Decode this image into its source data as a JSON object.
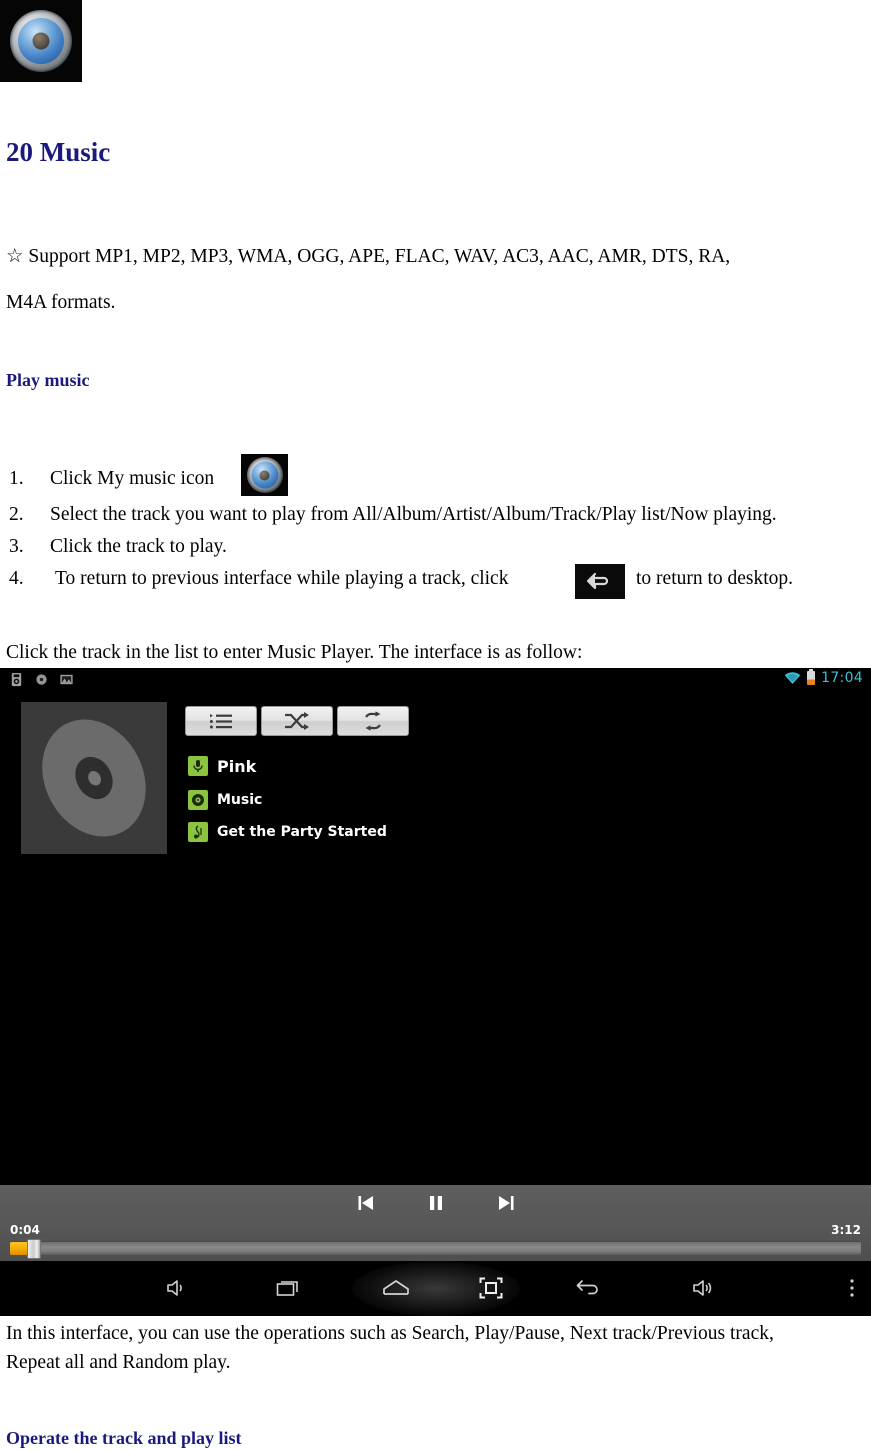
{
  "document": {
    "app_icon_name": "music-app-icon",
    "heading": "20 Music",
    "formats_line1": "☆  Support MP1, MP2, MP3, WMA, OGG, APE, FLAC, WAV, AC3, AAC, AMR, DTS, RA,",
    "formats_line2": "M4A formats.",
    "subheading_play": "Play music",
    "subheading_operate": "Operate the track and play list",
    "caption_follow": "Click the track in the list to enter Music Player. The interface is as follow:",
    "after_line1": "In this interface, you can use the operations such as Search, Play/Pause, Next track/Previous track,",
    "after_line2": "Repeat all and Random play.",
    "heading_color": "#1a1a7e",
    "steps": [
      {
        "num": "1.",
        "text": "Click My music icon"
      },
      {
        "num": "2.",
        "text": "Select the track you want to play from All/Album/Artist/Album/Track/Play list/Now playing."
      },
      {
        "num": "3.",
        "text": "Click the track to play."
      },
      {
        "num": "4.",
        "text_before": " To return to previous interface while playing a track, click",
        "text_after": "to return to desktop."
      }
    ]
  },
  "tablet": {
    "status_bar": {
      "notification_icons": [
        "usb-android-icon",
        "record-icon",
        "picture-icon"
      ],
      "wifi_icon": "wifi-icon",
      "battery_icon": "battery-icon",
      "clock": "17:04",
      "accent_color": "#3fbfd4"
    },
    "album_art": {
      "name": "album-art-placeholder",
      "icon": "cd-disc-icon"
    },
    "mode_buttons": [
      {
        "name": "playlist-button",
        "icon": "playlist-icon"
      },
      {
        "name": "shuffle-button",
        "icon": "shuffle-icon"
      },
      {
        "name": "repeat-button",
        "icon": "repeat-icon"
      }
    ],
    "now_playing": {
      "artist": "Pink",
      "artist_icon": "microphone-icon",
      "album": "Music",
      "album_icon": "disc-icon",
      "track": "Get the Party Started",
      "track_icon": "music-note-icon",
      "badge_color": "#8bc53f"
    },
    "player": {
      "prev_label": "previous-track",
      "pause_label": "pause",
      "next_label": "next-track",
      "elapsed": "0:04",
      "duration": "3:12",
      "progress_percent": 2,
      "progress_color": "#f5a800"
    },
    "nav_bar": {
      "buttons": [
        {
          "name": "volume-up-button",
          "icon": "volume-up-icon"
        },
        {
          "name": "recent-apps-button",
          "icon": "recent-apps-icon"
        },
        {
          "name": "home-button",
          "icon": "home-icon"
        },
        {
          "name": "screenshot-button",
          "icon": "screenshot-icon"
        },
        {
          "name": "back-button",
          "icon": "back-arrow-icon"
        },
        {
          "name": "volume-down-button",
          "icon": "volume-down-icon"
        },
        {
          "name": "overflow-menu-button",
          "icon": "more-vertical-icon"
        }
      ]
    }
  }
}
